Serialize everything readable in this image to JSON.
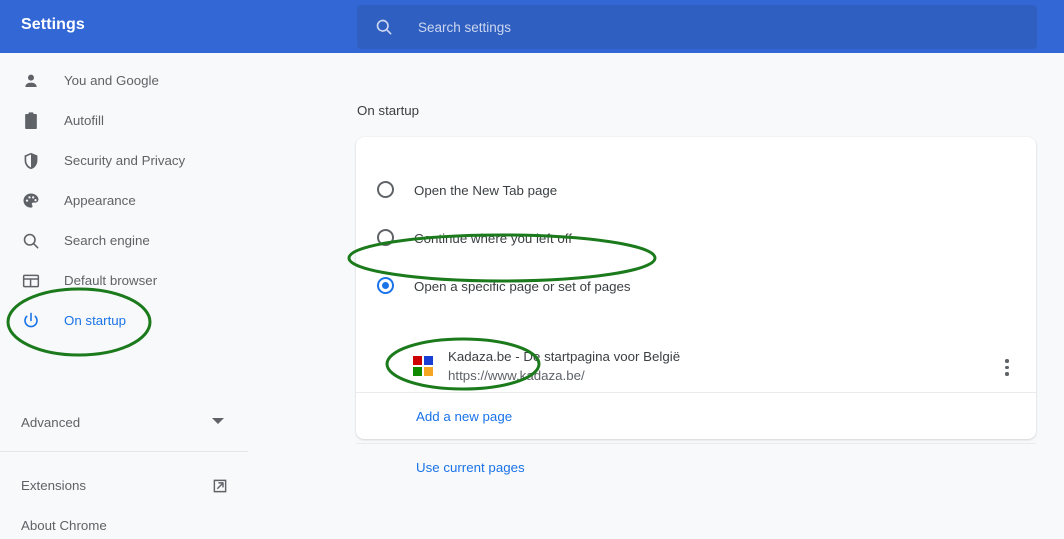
{
  "header": {
    "title": "Settings",
    "search_icon": "search-icon",
    "search_placeholder": "Search settings",
    "background_color": "#3367d6",
    "search_background_color": "#2f5fc0"
  },
  "sidebar": {
    "items": [
      {
        "label": "You and Google",
        "icon": "person-icon",
        "selected": false
      },
      {
        "label": "Autofill",
        "icon": "clipboard-icon",
        "selected": false
      },
      {
        "label": "Security and Privacy",
        "icon": "shield-icon",
        "selected": false
      },
      {
        "label": "Appearance",
        "icon": "palette-icon",
        "selected": false
      },
      {
        "label": "Search engine",
        "icon": "magnifier-icon",
        "selected": false
      },
      {
        "label": "Default browser",
        "icon": "browser-window-icon",
        "selected": false
      },
      {
        "label": "On startup",
        "icon": "power-icon",
        "selected": true
      }
    ],
    "advanced": {
      "label": "Advanced",
      "icon": "chevron-down-icon"
    },
    "bottom_items": [
      {
        "label": "Extensions",
        "icon": "open-in-new-icon"
      },
      {
        "label": "About Chrome",
        "icon": ""
      }
    ],
    "selected_color": "#1a73e8",
    "text_color": "#5f6368"
  },
  "main": {
    "section_title": "On startup",
    "radio_options": [
      {
        "label": "Open the New Tab page",
        "checked": false
      },
      {
        "label": "Continue where you left off",
        "checked": false
      },
      {
        "label": "Open a specific page or set of pages",
        "checked": true
      }
    ],
    "startup_page": {
      "title": "Kadaza.be - De startpagina voor België",
      "url": "https://www.kadaza.be/",
      "favicon_colors": [
        "#cc0000",
        "#1a3fd4",
        "#108a00",
        "#f5a623"
      ],
      "menu_icon": "more-vertical-icon"
    },
    "links": [
      {
        "label": "Add a new page"
      },
      {
        "label": "Use current pages"
      }
    ],
    "link_color": "#1a73e8"
  },
  "annotations": {
    "color": "#1b7a1b",
    "ellipses": [
      {
        "name": "annotation-on-startup-sidebar"
      },
      {
        "name": "annotation-open-specific-page-radio"
      },
      {
        "name": "annotation-add-a-new-page-link"
      }
    ]
  }
}
